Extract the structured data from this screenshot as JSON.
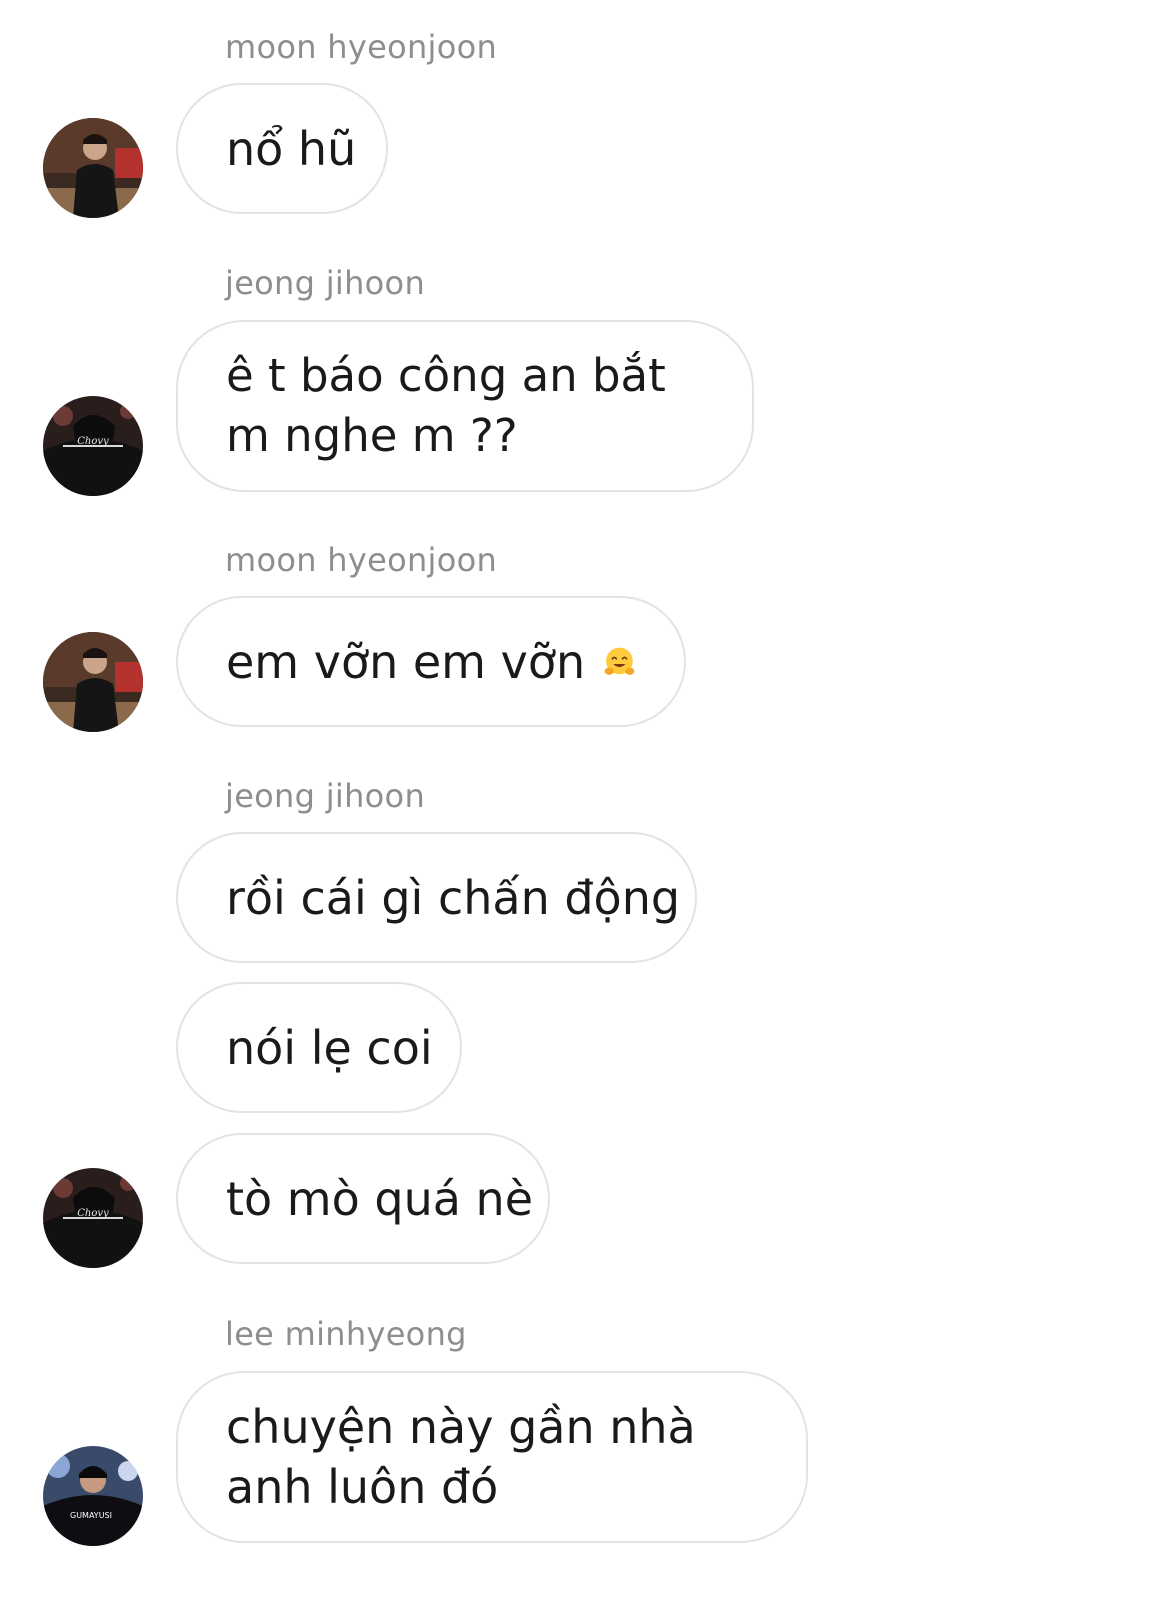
{
  "messages": [
    {
      "sender": "moon hyeonjoon",
      "bubbles": [
        "nổ hũ"
      ]
    },
    {
      "sender": "jeong jihoon",
      "bubbles": [
        "ê t báo công an bắt m nghe m ??"
      ]
    },
    {
      "sender": "moon hyeonjoon",
      "bubbles": [
        "em vỡn em vỡn"
      ],
      "emoji": "hugging-face-emoji"
    },
    {
      "sender": "jeong jihoon",
      "bubbles": [
        "rồi cái gì chấn động",
        "nói lẹ coi",
        "tò mò quá nè"
      ]
    },
    {
      "sender": "lee minhyeong",
      "bubbles": [
        "chuyện này gần nhà anh luôn đó"
      ]
    }
  ],
  "avatars": {
    "moon": {
      "jersey_text": ""
    },
    "jeong": {
      "jersey_text": "Chovy"
    },
    "lee": {
      "jersey_text": "GUMAYUSI"
    }
  },
  "colors": {
    "bubble_border": "#e3e3e3",
    "sender_text": "#8e8e8e",
    "message_text": "#1a1a1a"
  }
}
